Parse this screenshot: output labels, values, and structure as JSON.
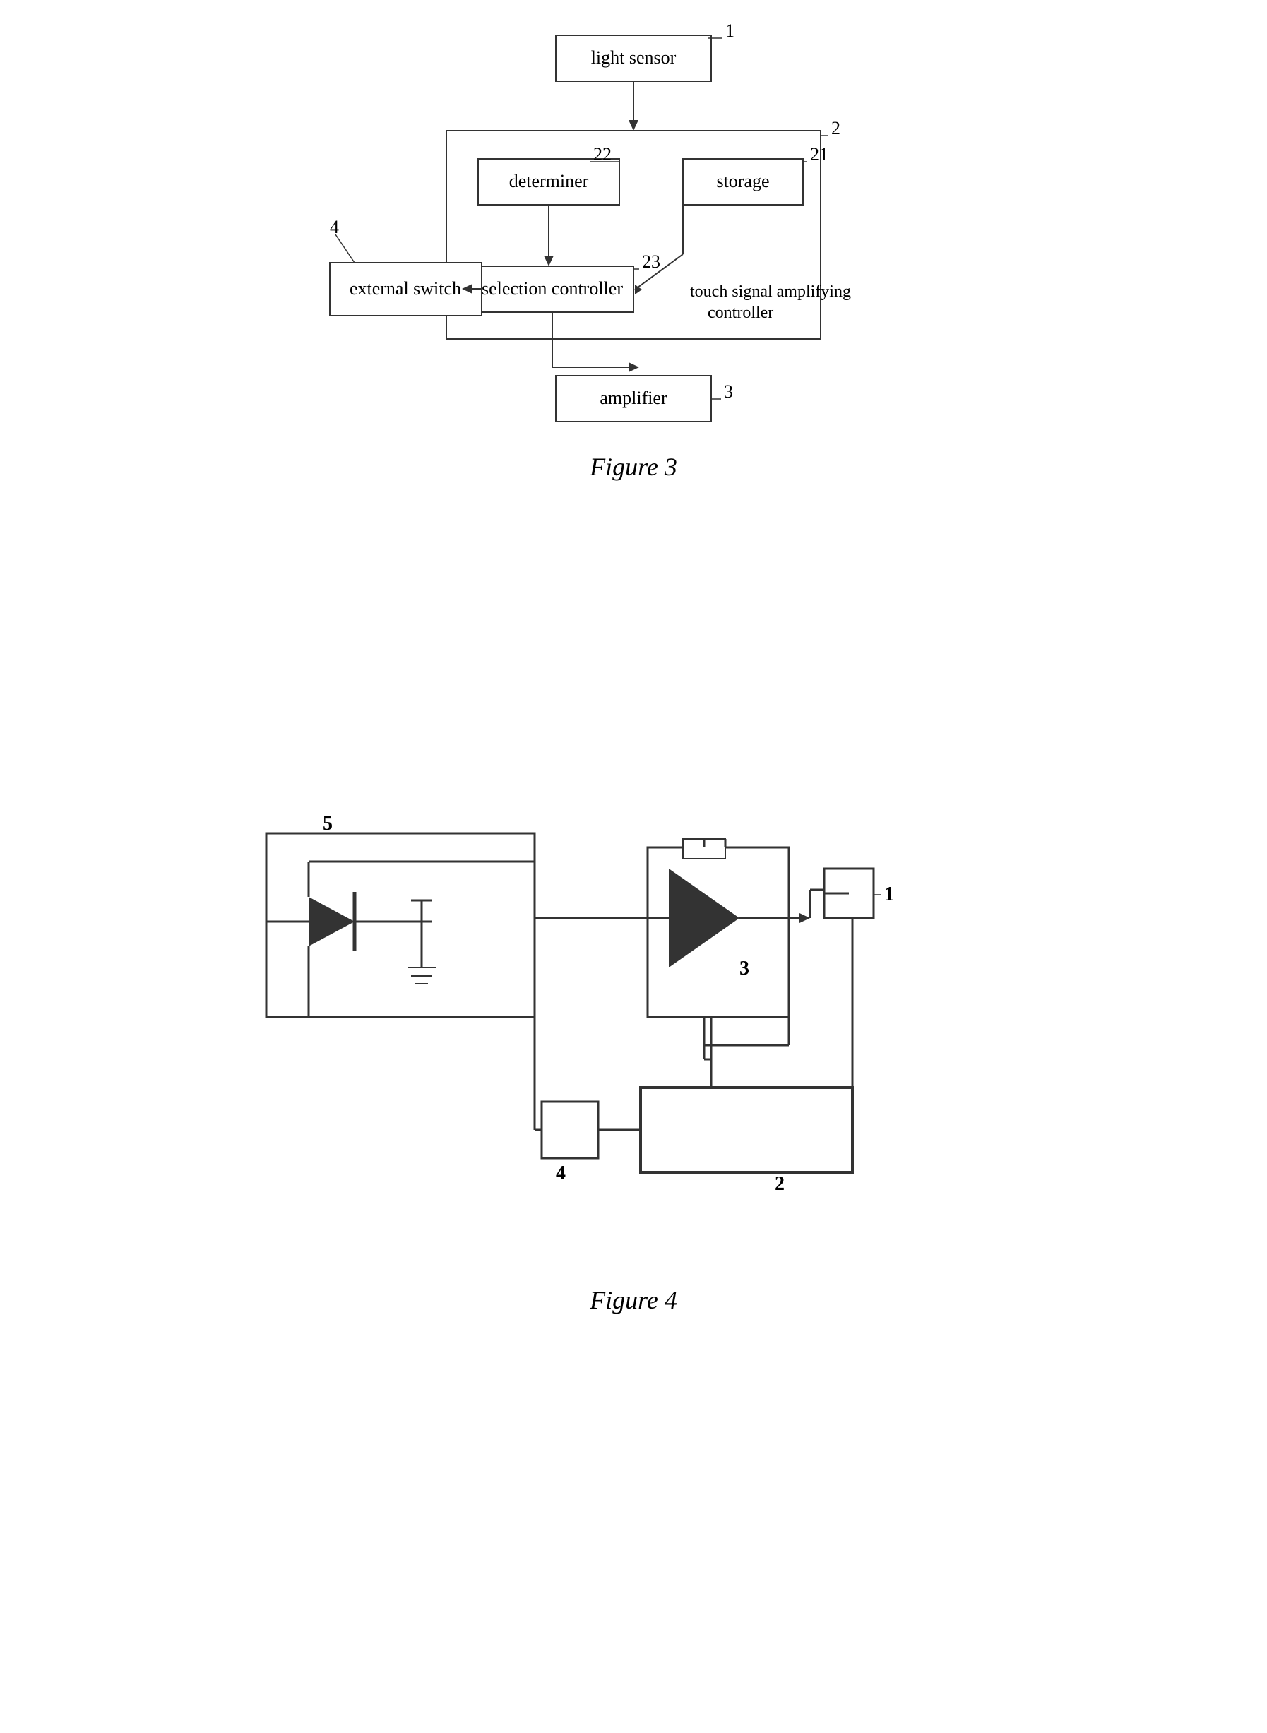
{
  "figure3": {
    "caption": "Figure 3",
    "blocks": {
      "light_sensor": "light sensor",
      "determiner": "determiner",
      "storage": "storage",
      "selection_controller": "selection controller",
      "external_switch": "external switch",
      "amplifier": "amplifier",
      "outer_label": "touch signal amplifying\ncontroller"
    },
    "labels": {
      "n1": "1",
      "n2": "2",
      "n21": "21",
      "n22": "22",
      "n23": "23",
      "n3": "3",
      "n4": "4"
    }
  },
  "figure4": {
    "caption": "Figure 4",
    "labels": {
      "n1": "1",
      "n2": "2",
      "n3": "3",
      "n4": "4",
      "n5": "5"
    }
  }
}
